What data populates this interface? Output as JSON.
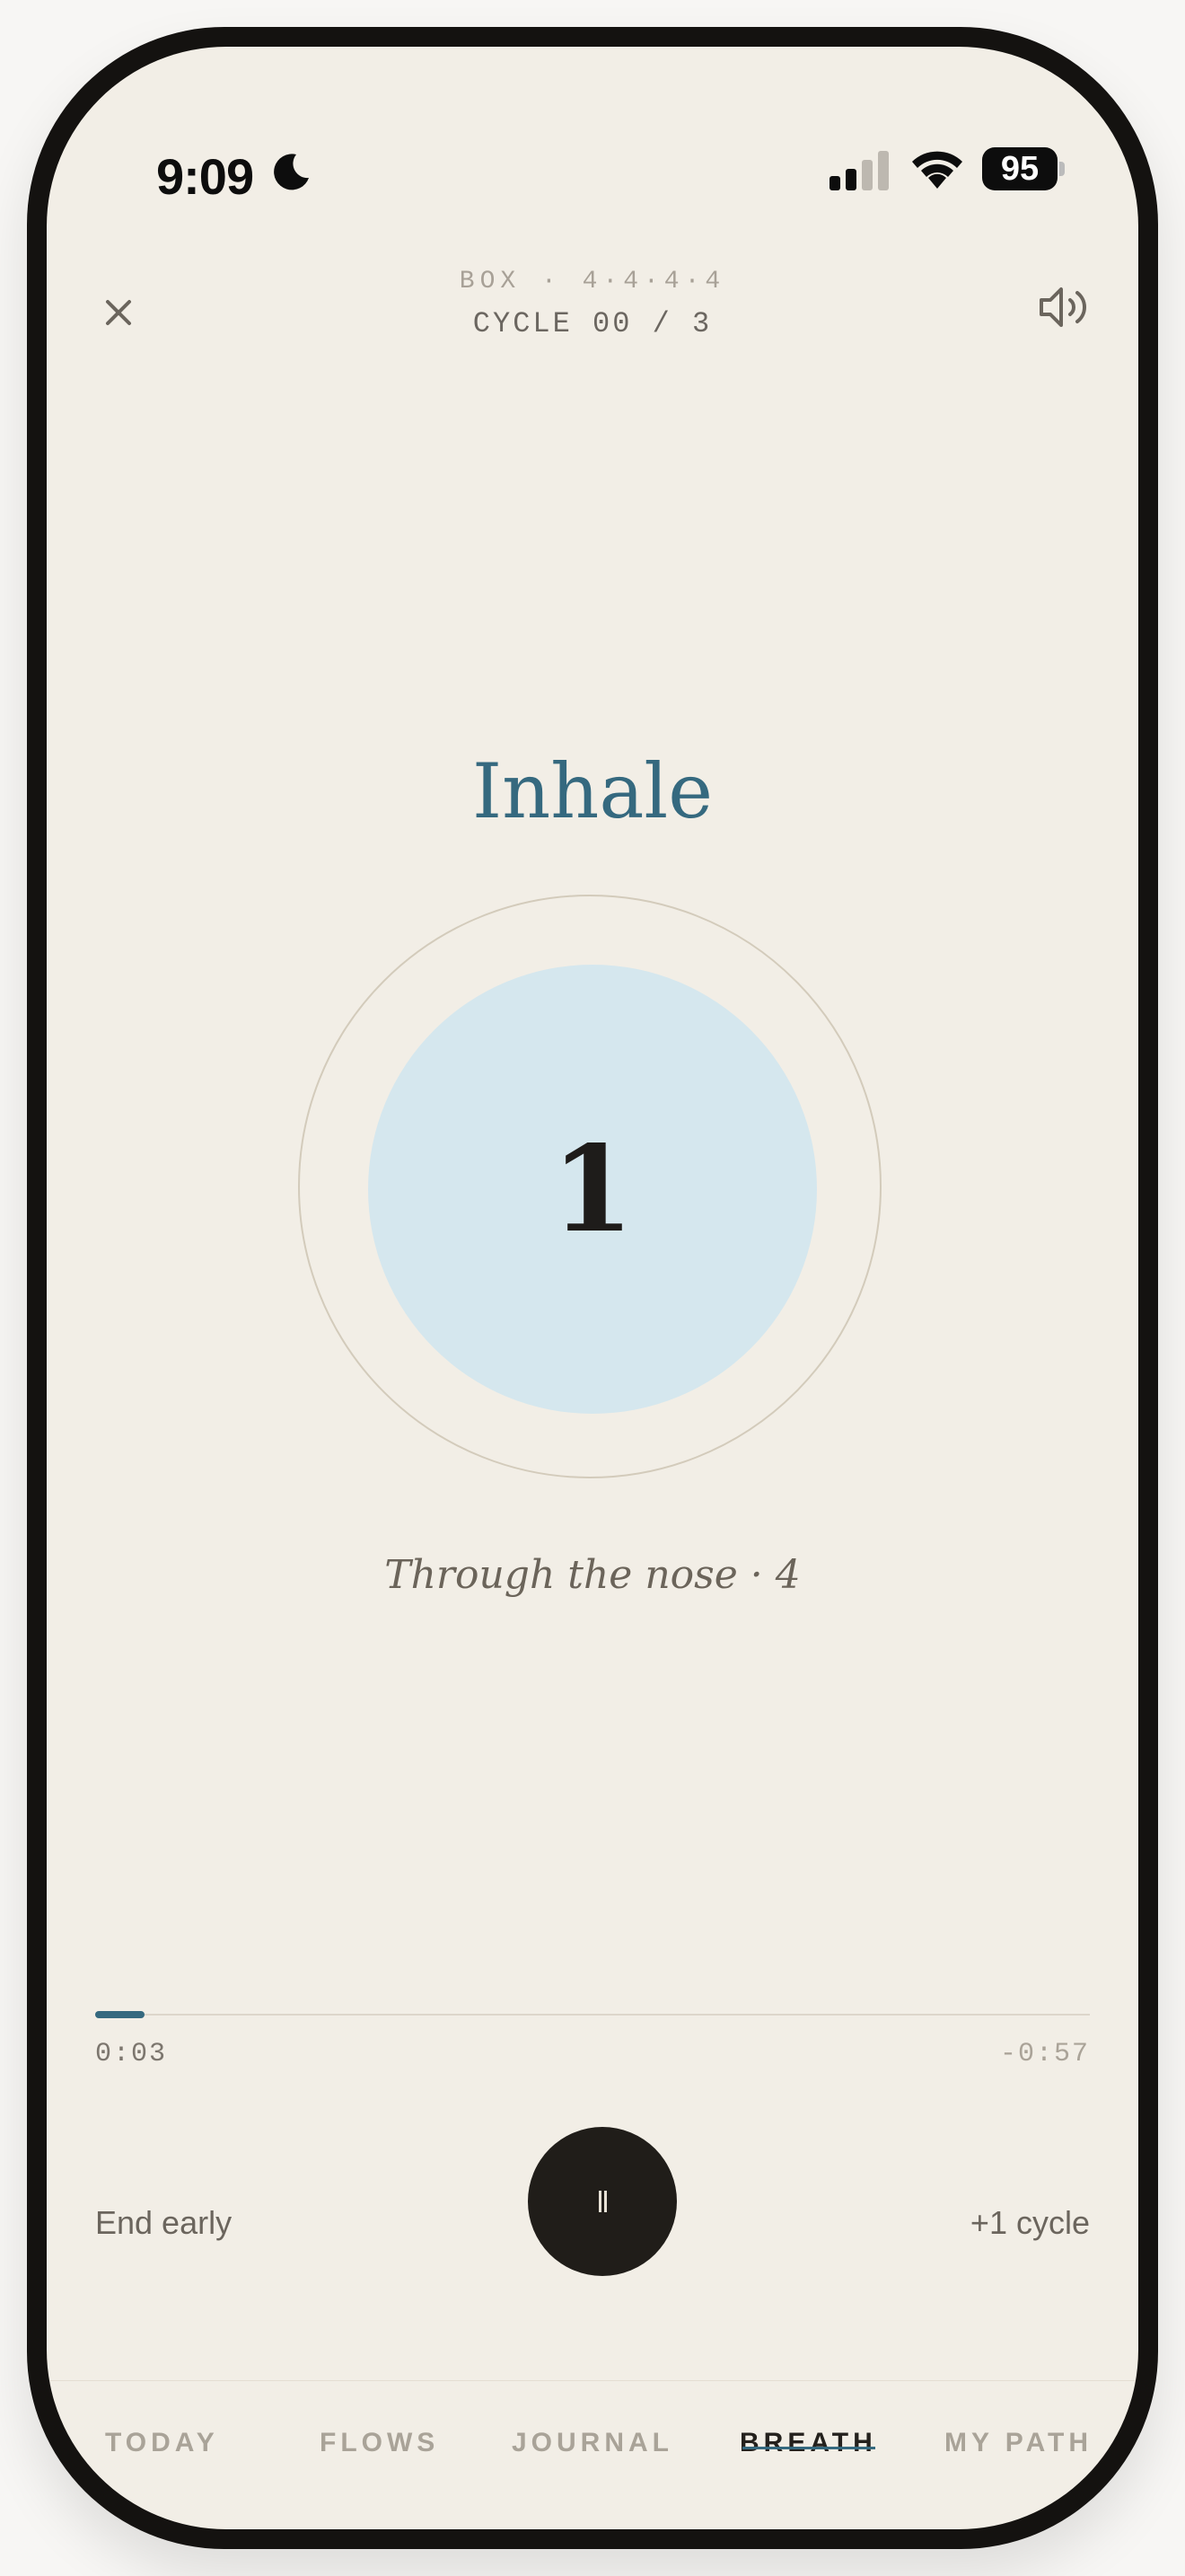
{
  "status_bar": {
    "time": "9:09",
    "battery": "95",
    "icons": [
      "moon-icon",
      "signal-icon",
      "wifi-icon",
      "battery-icon"
    ]
  },
  "header": {
    "close_icon": "close-icon",
    "preset": "BOX · 4·4·4·4",
    "cycle": "CYCLE 00 / 3",
    "sound_icon": "speaker-icon"
  },
  "session": {
    "phase": "Inhale",
    "count": "1",
    "hint": "Through the nose · 4",
    "progress": 0.05
  },
  "timer": {
    "elapsed": "0:03",
    "remaining": "-0:57"
  },
  "controls": {
    "end_early": "End early",
    "pause_icon": "pause-icon",
    "add_cycle": "+1 cycle"
  },
  "tabs": [
    {
      "label": "TODAY",
      "active": false
    },
    {
      "label": "FLOWS",
      "active": false
    },
    {
      "label": "JOURNAL",
      "active": false
    },
    {
      "label": "BREATH",
      "active": true
    },
    {
      "label": "MY PATH",
      "active": false
    }
  ],
  "colors": {
    "background": "#f2eee6",
    "accent": "#35697f",
    "orb": "#d5e7ee",
    "button": "#201d19"
  }
}
